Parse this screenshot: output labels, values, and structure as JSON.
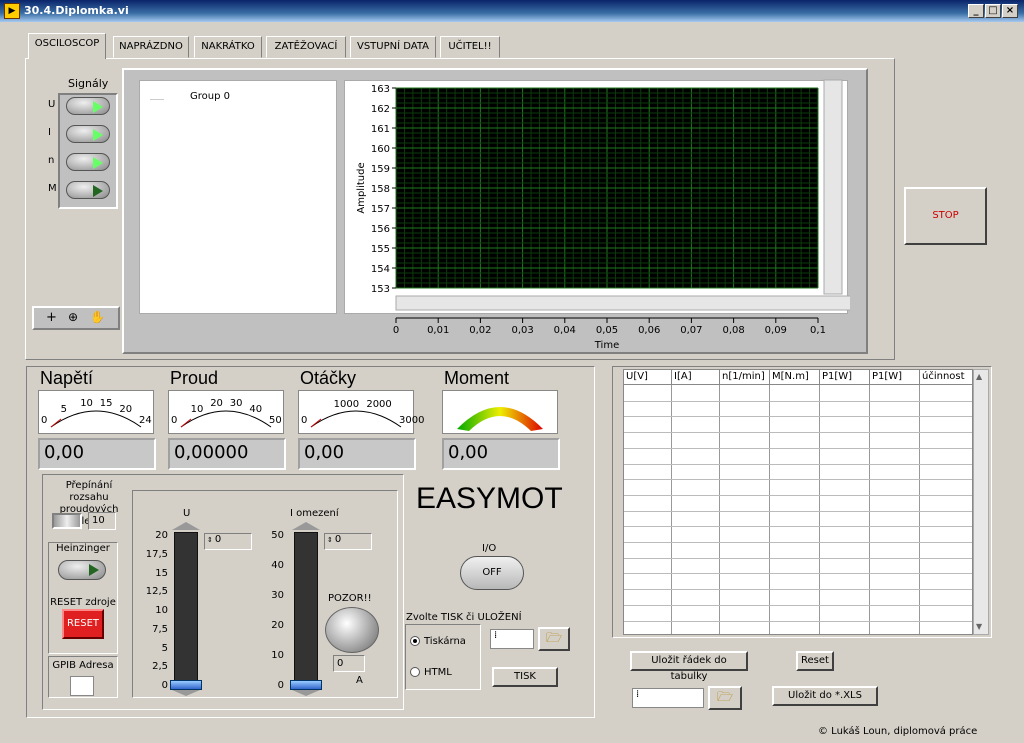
{
  "window": {
    "title": "30.4.Diplomka.vi",
    "minimize": "_",
    "maximize": "□",
    "close": "×"
  },
  "tabs": [
    "OSCILOSCOP",
    "NAPRÁZDNO",
    "NAKRÁTKO",
    "ZATĚŽOVACÍ",
    "VSTUPNÍ DATA",
    "UČITEL!!"
  ],
  "signals": {
    "title": "Signály",
    "items": [
      {
        "label": "U",
        "on": true
      },
      {
        "label": "I",
        "on": true
      },
      {
        "label": "n",
        "on": true
      },
      {
        "label": "M",
        "on": false
      }
    ]
  },
  "legend": {
    "group": "Group 0"
  },
  "chart_data": {
    "type": "line",
    "title": "",
    "xlabel": "Time",
    "ylabel": "Amplitude",
    "xlim": [
      0,
      0.1
    ],
    "ylim": [
      153,
      163
    ],
    "xticks": [
      "0",
      "0,01",
      "0,02",
      "0,03",
      "0,04",
      "0,05",
      "0,06",
      "0,07",
      "0,08",
      "0,09",
      "0,1"
    ],
    "yticks": [
      "163",
      "162",
      "161",
      "160",
      "159",
      "158",
      "157",
      "156",
      "155",
      "154",
      "153"
    ],
    "series": [],
    "grid": true
  },
  "stop": {
    "label": "STOP"
  },
  "meters": [
    {
      "title": "Napětí",
      "value": "0,00",
      "scale": [
        "0",
        "5",
        "10",
        "15",
        "20",
        "24"
      ]
    },
    {
      "title": "Proud",
      "value": "0,00000",
      "scale": [
        "0",
        "10",
        "20",
        "30",
        "40",
        "50"
      ]
    },
    {
      "title": "Otáčky",
      "value": "0,00",
      "scale": [
        "0",
        "1000",
        "2000",
        "3000"
      ]
    },
    {
      "title": "Moment",
      "value": "0,00",
      "scale": []
    }
  ],
  "range": {
    "label": "Přepínání rozsahu proudových kleští",
    "value": "10"
  },
  "heinzinger": {
    "label": "Heinzinger"
  },
  "reset_src": {
    "label": "RESET zdroje",
    "button": "RESET"
  },
  "gpib": {
    "label": "GPIB Adresa",
    "value": ""
  },
  "slider_u": {
    "label": "U",
    "value": "0",
    "ticks": [
      "20",
      "17,5",
      "15",
      "12,5",
      "10",
      "7,5",
      "5",
      "2,5",
      "0"
    ]
  },
  "slider_i": {
    "label": "I omezení",
    "value": "0",
    "ticks": [
      "50",
      "40",
      "30",
      "20",
      "10",
      "0"
    ]
  },
  "warning": {
    "label": "POZOR!!",
    "value": "0",
    "unit": "A"
  },
  "brand": "EASYMOT",
  "io": {
    "label": "I/O",
    "button": "OFF"
  },
  "print": {
    "label": "Zvolte TISK či ULOŽENÍ",
    "opt1": "Tiskárna",
    "opt2": "HTML",
    "path": "",
    "button": "TISK"
  },
  "table": {
    "headers": [
      "U[V]",
      "I[A]",
      "n[1/min]",
      "M[N.m]",
      "P1[W]",
      "P1[W]",
      "účinnost"
    ]
  },
  "table_buttons": {
    "save_row": "Uložit řádek do tabulky",
    "reset": "Reset",
    "save_xls": "Uložit do *.XLS",
    "path": ""
  },
  "footer": "© Lukáš Loun, diplomová práce"
}
